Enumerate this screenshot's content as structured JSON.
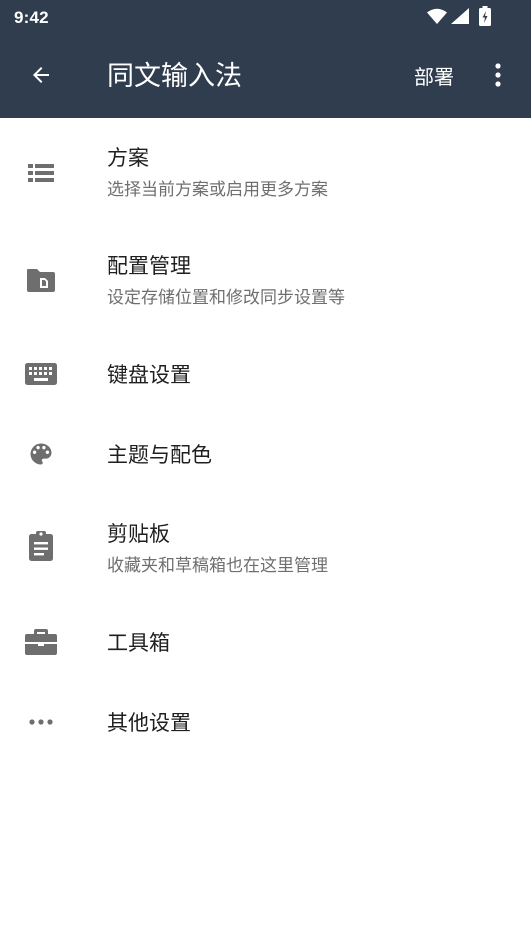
{
  "status_bar": {
    "time": "9:42",
    "icons": [
      "wifi-icon",
      "cell-signal-icon",
      "battery-charging-icon"
    ]
  },
  "app_bar": {
    "title": "同文输入法",
    "action_label": "部署",
    "icons": [
      "back-arrow-icon",
      "more-vert-icon"
    ],
    "background": "#2f3d4f"
  },
  "menu": {
    "items": [
      {
        "title": "方案",
        "subtitle": "选择当前方案或启用更多方案",
        "icon": "list-icon"
      },
      {
        "title": "配置管理",
        "subtitle": "设定存储位置和修改同步设置等",
        "icon": "folder-icon"
      },
      {
        "title": "键盘设置",
        "icon": "keyboard-icon"
      },
      {
        "title": "主题与配色",
        "icon": "palette-icon"
      },
      {
        "title": "剪贴板",
        "subtitle": "收藏夹和草稿箱也在这里管理",
        "icon": "clipboard-icon"
      },
      {
        "title": "工具箱",
        "icon": "toolbox-icon"
      },
      {
        "title": "其他设置",
        "icon": "more-horiz-icon"
      }
    ]
  },
  "colors": {
    "icon_gray": "#6e6e6e",
    "title_text": "#1f1f1f",
    "subtitle_text": "#6f6f6f"
  }
}
